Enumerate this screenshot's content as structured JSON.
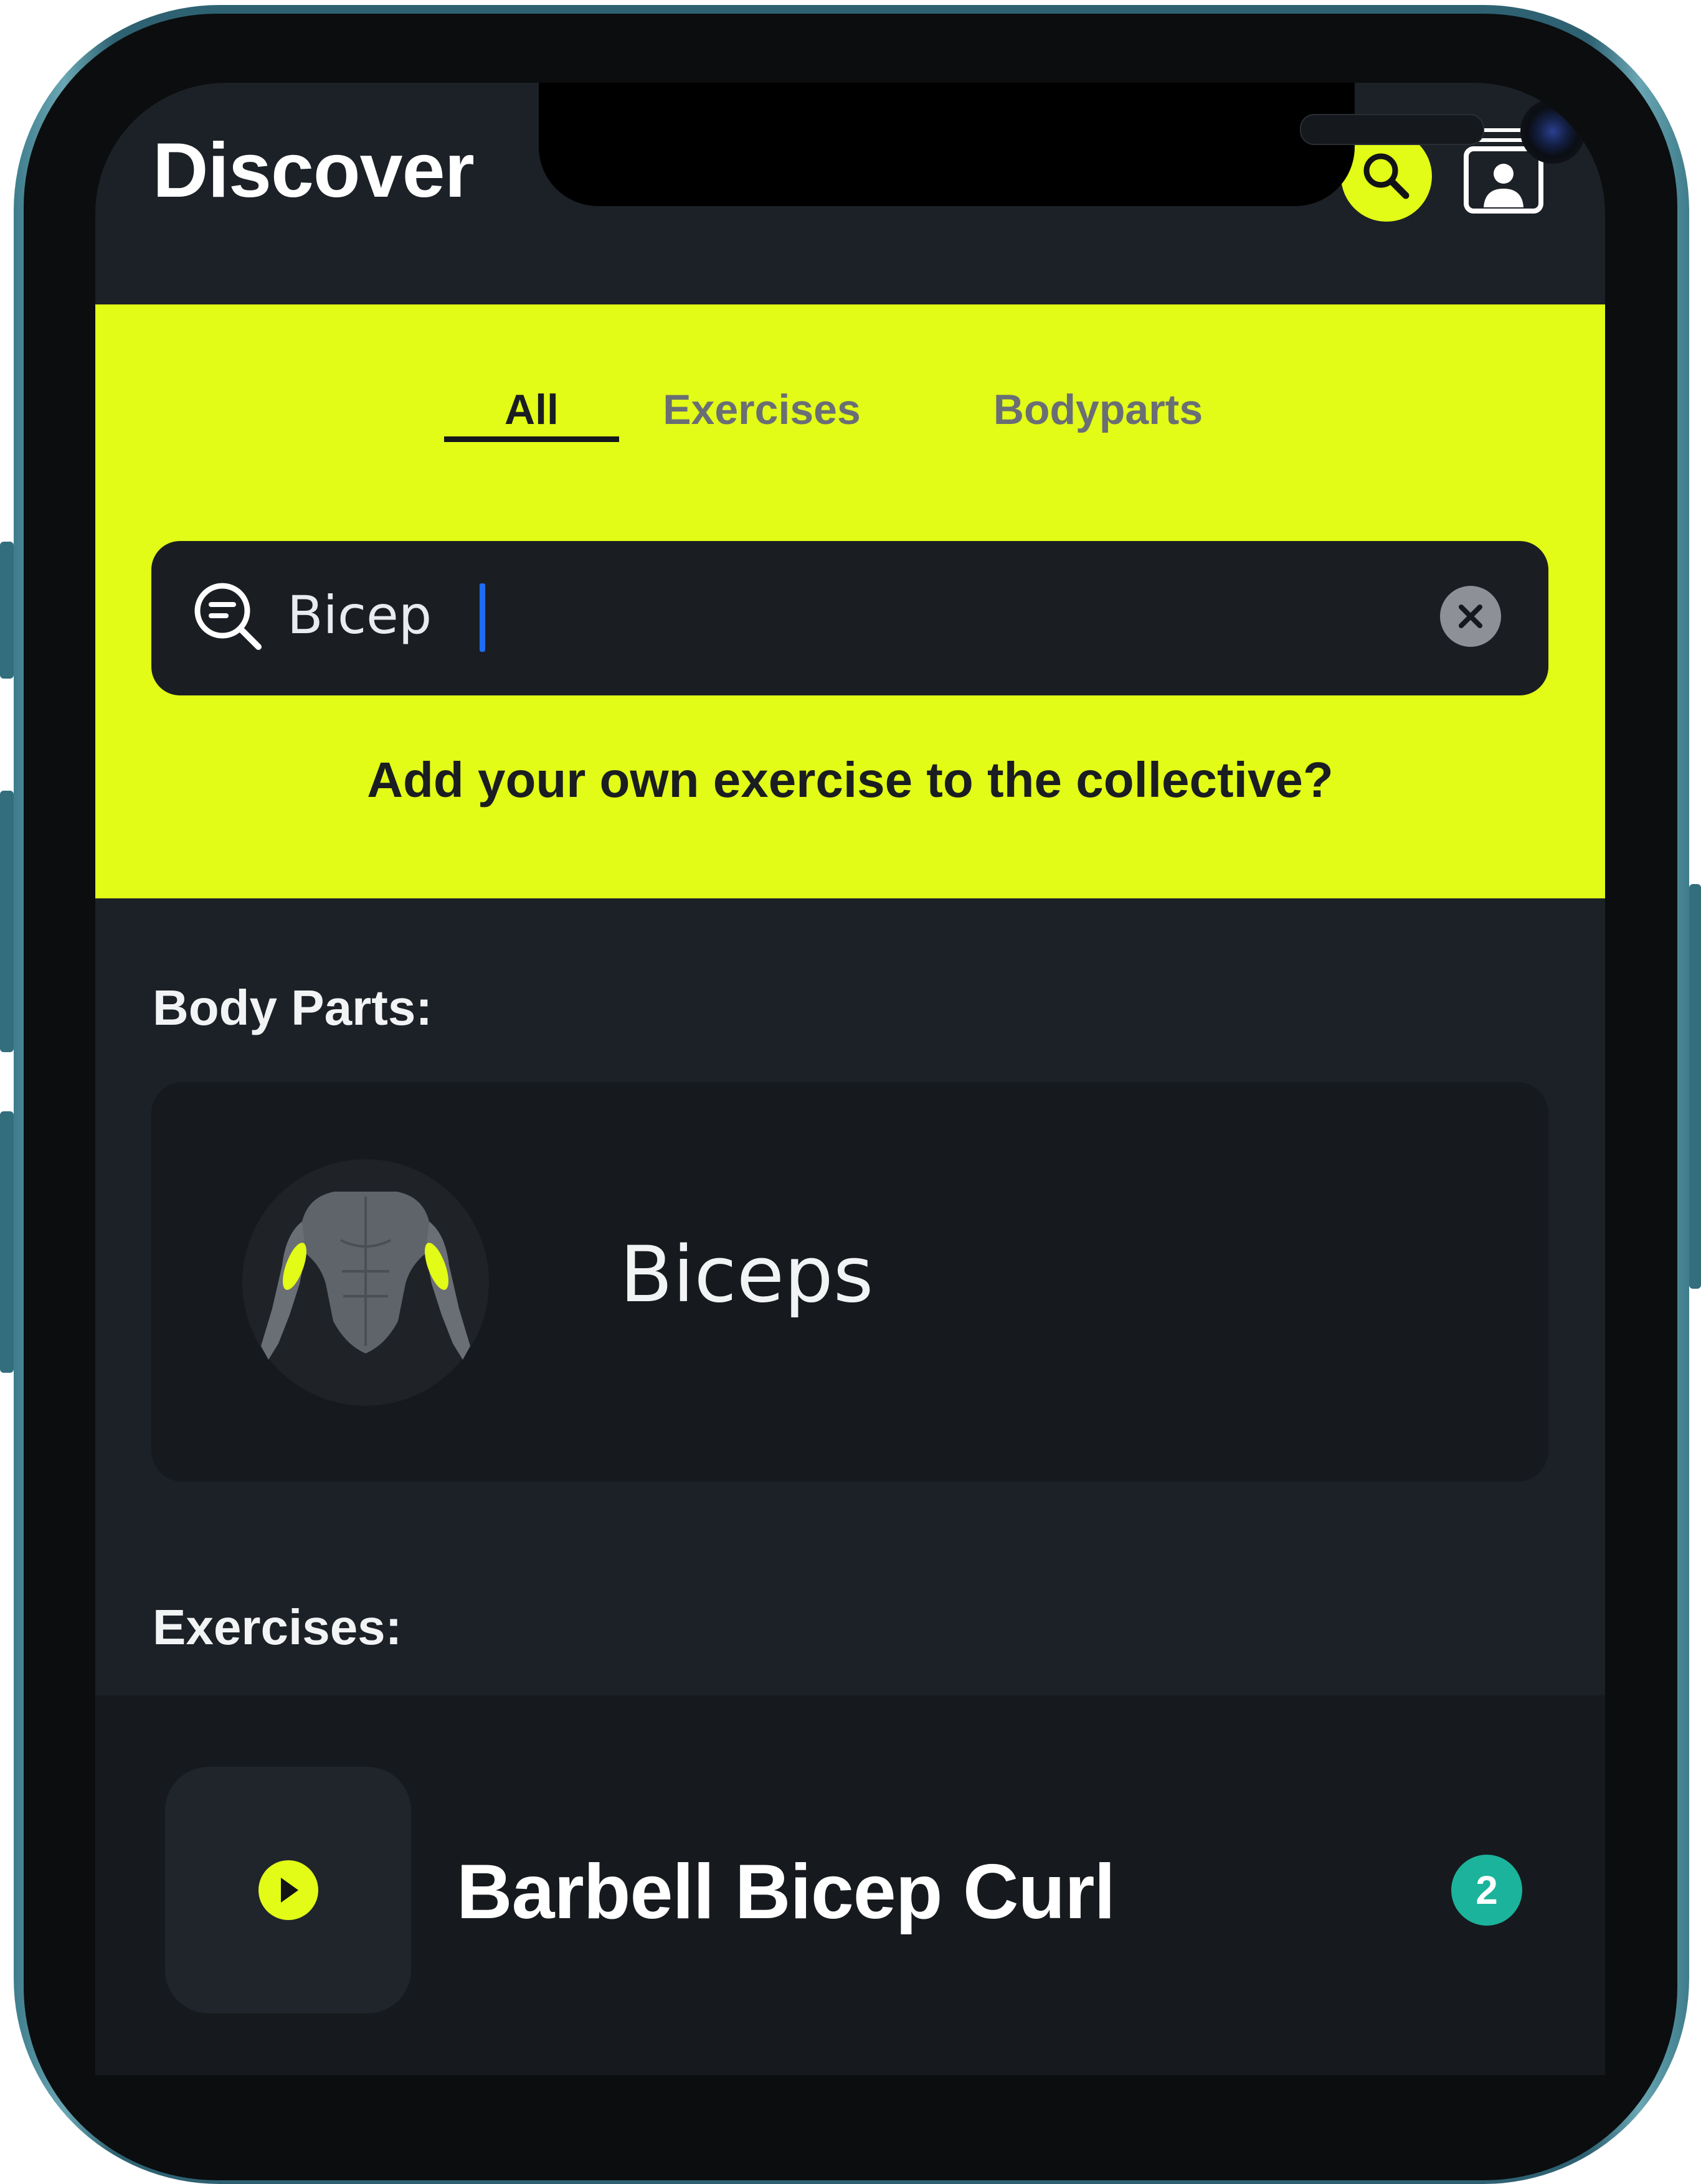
{
  "header": {
    "title": "Discover",
    "search_icon": "search-icon",
    "profile_icon": "profile-cards-icon"
  },
  "tabs": [
    {
      "label": "All",
      "active": true
    },
    {
      "label": "Exercises",
      "active": false
    },
    {
      "label": "Bodyparts",
      "active": false
    }
  ],
  "search": {
    "value": "Bicep",
    "icon": "search-list-icon",
    "clear_icon": "clear-icon"
  },
  "add_prompt": "Add your own exercise to the collective?",
  "body_parts": {
    "label": "Body Parts:",
    "items": [
      {
        "name": "Biceps",
        "icon": "torso-biceps-icon"
      }
    ]
  },
  "exercises": {
    "label": "Exercises:",
    "items": [
      {
        "name": "Barbell Bicep Curl",
        "count": "2",
        "icon": "play-icon"
      }
    ]
  },
  "colors": {
    "accent": "#E2FB17",
    "background": "#1C2127",
    "card": "#161A1E",
    "badge": "#1BB39B"
  }
}
